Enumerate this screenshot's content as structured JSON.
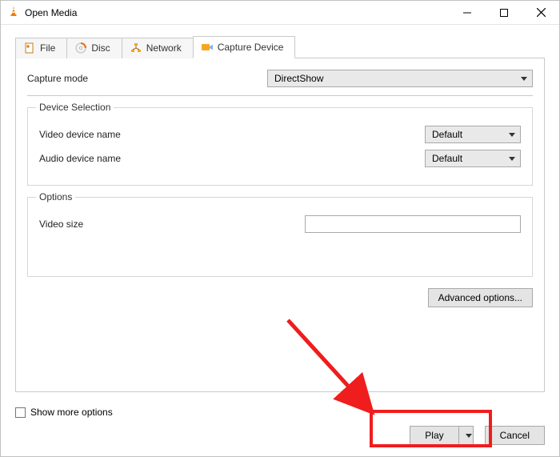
{
  "window": {
    "title": "Open Media"
  },
  "tabs": {
    "file": "File",
    "disc": "Disc",
    "network": "Network",
    "capture": "Capture Device"
  },
  "capture_panel": {
    "capture_mode_label": "Capture mode",
    "capture_mode_value": "DirectShow",
    "device_selection_title": "Device Selection",
    "video_device_label": "Video device name",
    "video_device_value": "Default",
    "audio_device_label": "Audio device name",
    "audio_device_value": "Default",
    "options_title": "Options",
    "video_size_label": "Video size",
    "video_size_value": "",
    "advanced_btn": "Advanced options..."
  },
  "footer": {
    "show_more": "Show more options",
    "play": "Play",
    "cancel": "Cancel"
  }
}
